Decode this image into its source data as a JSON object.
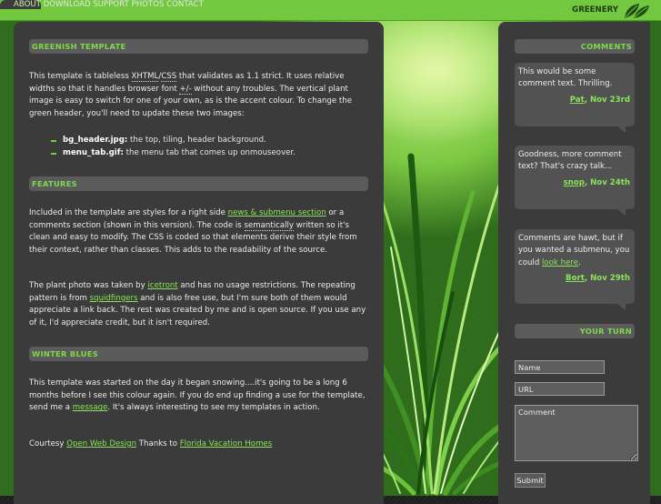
{
  "nav": {
    "items": [
      {
        "label": "ABOUT",
        "active": true
      },
      {
        "label": "DOWNLOAD"
      },
      {
        "label": "SUPPORT"
      },
      {
        "label": "PHOTOS"
      },
      {
        "label": "CONTACT"
      }
    ],
    "brand": "GREENERY"
  },
  "main": {
    "sections": [
      {
        "title": "GREENISH TEMPLATE"
      },
      {
        "title": "FEATURES"
      },
      {
        "title": "WINTER BLUES"
      }
    ],
    "intro": {
      "p1": "This template is tableless ",
      "xhtml": "XHTML",
      "slash": "/",
      "css": "CSS",
      "p2": " that validates as 1.1 strict. It uses relative widths so that it handles browser font ",
      "pm": "+/-",
      "p3": " without any troubles. The vertical plant image is easy to switch for one of your own, as is the accent colour. To change the green header, you'll need to update these two images:"
    },
    "bullets": [
      {
        "file": "bg_header.jpg:",
        "desc": " the top, tiling, header background."
      },
      {
        "file": "menu_tab.gif:",
        "desc": " the menu tab that comes up onmouseover."
      }
    ],
    "features": {
      "p1": "Included in the template are styles for a right side ",
      "link1": "news & submenu section",
      "p2": " or a comments section (shown in this version). The code is ",
      "sem": "semantically",
      "p3": " written so it's clean and easy to modify. The CSS is coded so that elements derive their style from their context, rather than classes. This adds to the readability of the source."
    },
    "credits": {
      "p1": "The plant photo was taken by ",
      "link1": "icetront",
      "p2": " and has no usage restrictions. The repeating pattern is from ",
      "link2": "squidfingers",
      "p3": " and is also free use, but I'm sure both of them would appreciate a link back. The rest was created by me and is open source. If you use any of it, I'd appreciate credit, but it isn't required."
    },
    "winter": {
      "p1": "This template was started on the day it began snowing....it's going to be a long 6 months before I see this colour again. If you do end up finding a use for the template, send me a ",
      "link1": "message",
      "p2": ". It's always interesting to see my templates in action."
    },
    "courtesy": {
      "p1": "Courtesy ",
      "link1": "Open Web Design",
      "p2": " Thanks to ",
      "link2": "Florida Vacation Homes"
    }
  },
  "sidebar": {
    "comments_title": "COMMENTS",
    "comments": [
      {
        "text": "This would be some comment text. Thrilling.",
        "author": "Pat",
        "date": ", Nov 23rd"
      },
      {
        "text": "Goodness, more comment text? That's crazy talk...",
        "author": "snop",
        "date": ", Nov 24th"
      },
      {
        "text_pre": "Comments are hawt, but if you wanted a submenu, you could ",
        "link": "look here",
        "text_post": ".",
        "author": "Bort",
        "date": ", Nov 29th"
      }
    ],
    "form_title": "YOUR TURN",
    "form": {
      "name": "Name",
      "url": "URL",
      "comment": "Comment",
      "submit": "Submit"
    }
  },
  "colors": {
    "accent": "#72c93f",
    "link": "#8ae45a",
    "panel": "#3b3b3b",
    "header_bar": "#5b5b5b"
  },
  "icons": {
    "logo": "leaf-logo-icon",
    "bullet": "dash-bullet-icon"
  }
}
